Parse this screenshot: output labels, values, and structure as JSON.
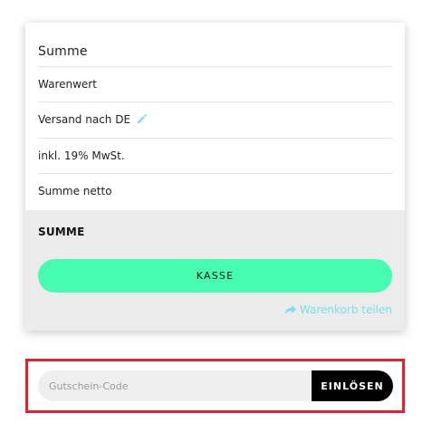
{
  "summary": {
    "header": "Summe",
    "rows": [
      {
        "label": "Warenwert"
      },
      {
        "label": "Versand nach DE",
        "icon": "pencil-icon"
      },
      {
        "label": "inkl. 19% MwSt."
      },
      {
        "label": "Summe netto"
      }
    ],
    "total_label": "SUMME",
    "checkout_label": "KASSE",
    "share_label": "Warenkorb teilen",
    "share_icon": "share-arrow-icon"
  },
  "coupon": {
    "placeholder": "Gutschein-Code",
    "value": "",
    "redeem_label": "EINLÖSEN"
  },
  "colors": {
    "accent": "#46fcb0",
    "link": "#7be0ee",
    "highlight_frame": "#e51f2e",
    "total_background": "#ececec",
    "redeem_background": "#000000"
  }
}
